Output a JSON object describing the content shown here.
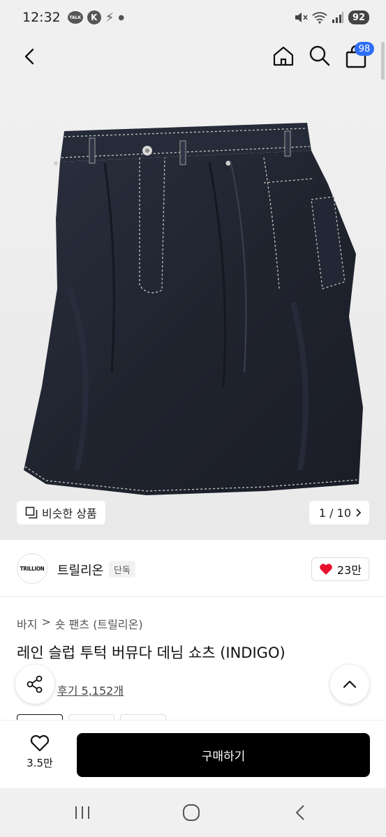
{
  "status_bar": {
    "time": "12:32",
    "talk_label": "TALK",
    "k_label": "K",
    "battery": "92"
  },
  "header": {
    "cart_count": "98"
  },
  "gallery": {
    "similar_label": "비슷한 상품",
    "counter": "1 / 10"
  },
  "brand": {
    "logo_text": "TRILLION",
    "name": "트릴리온",
    "tag": "단독",
    "likes": "23만"
  },
  "product": {
    "breadcrumb_category": "바지",
    "breadcrumb_separator": ">",
    "breadcrumb_sub": "숏 팬츠 (트릴리온)",
    "title": "레인 슬럽 투턱 버뮤다 데님 쇼츠 (INDIGO)",
    "review_link": "후기 5,152개"
  },
  "action_bar": {
    "wish_count": "3.5만",
    "buy_label": "구매하기"
  },
  "icons": {
    "accent_badge": "#2e6ef5",
    "heart_color": "#e8112d"
  }
}
